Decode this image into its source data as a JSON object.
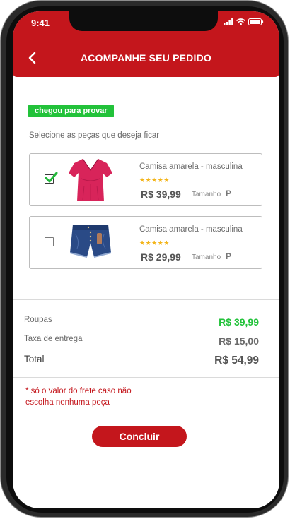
{
  "status_bar": {
    "time": "9:41"
  },
  "header": {
    "title": "ACOMPANHE SEU PEDIDO"
  },
  "order": {
    "status_badge": "chegou para provar",
    "instruction": "Selecione as peças que deseja ficar"
  },
  "products": [
    {
      "name": "Camisa amarela  - masculina",
      "stars": "★★★★★",
      "price": "R$ 39,99",
      "size_label": "Tamanho",
      "size": "P",
      "selected": true
    },
    {
      "name": "Camisa amarela  - masculina",
      "stars": "★★★★★",
      "price": "R$ 29,99",
      "size_label": "Tamanho",
      "size": "P",
      "selected": false
    }
  ],
  "summary": {
    "clothes_label": "Roupas",
    "clothes_value": "R$ 39,99",
    "delivery_label": "Taxa de entrega",
    "delivery_value": "R$ 15,00",
    "total_label": "Total",
    "total_value": "R$ 54,99"
  },
  "note": "* só o valor do frete caso não escolha nenhuma peça",
  "actions": {
    "conclude_label": "Concluir"
  },
  "colors": {
    "brand_red": "#c4161c",
    "success_green": "#22c23a",
    "star_yellow": "#f3b51b"
  }
}
